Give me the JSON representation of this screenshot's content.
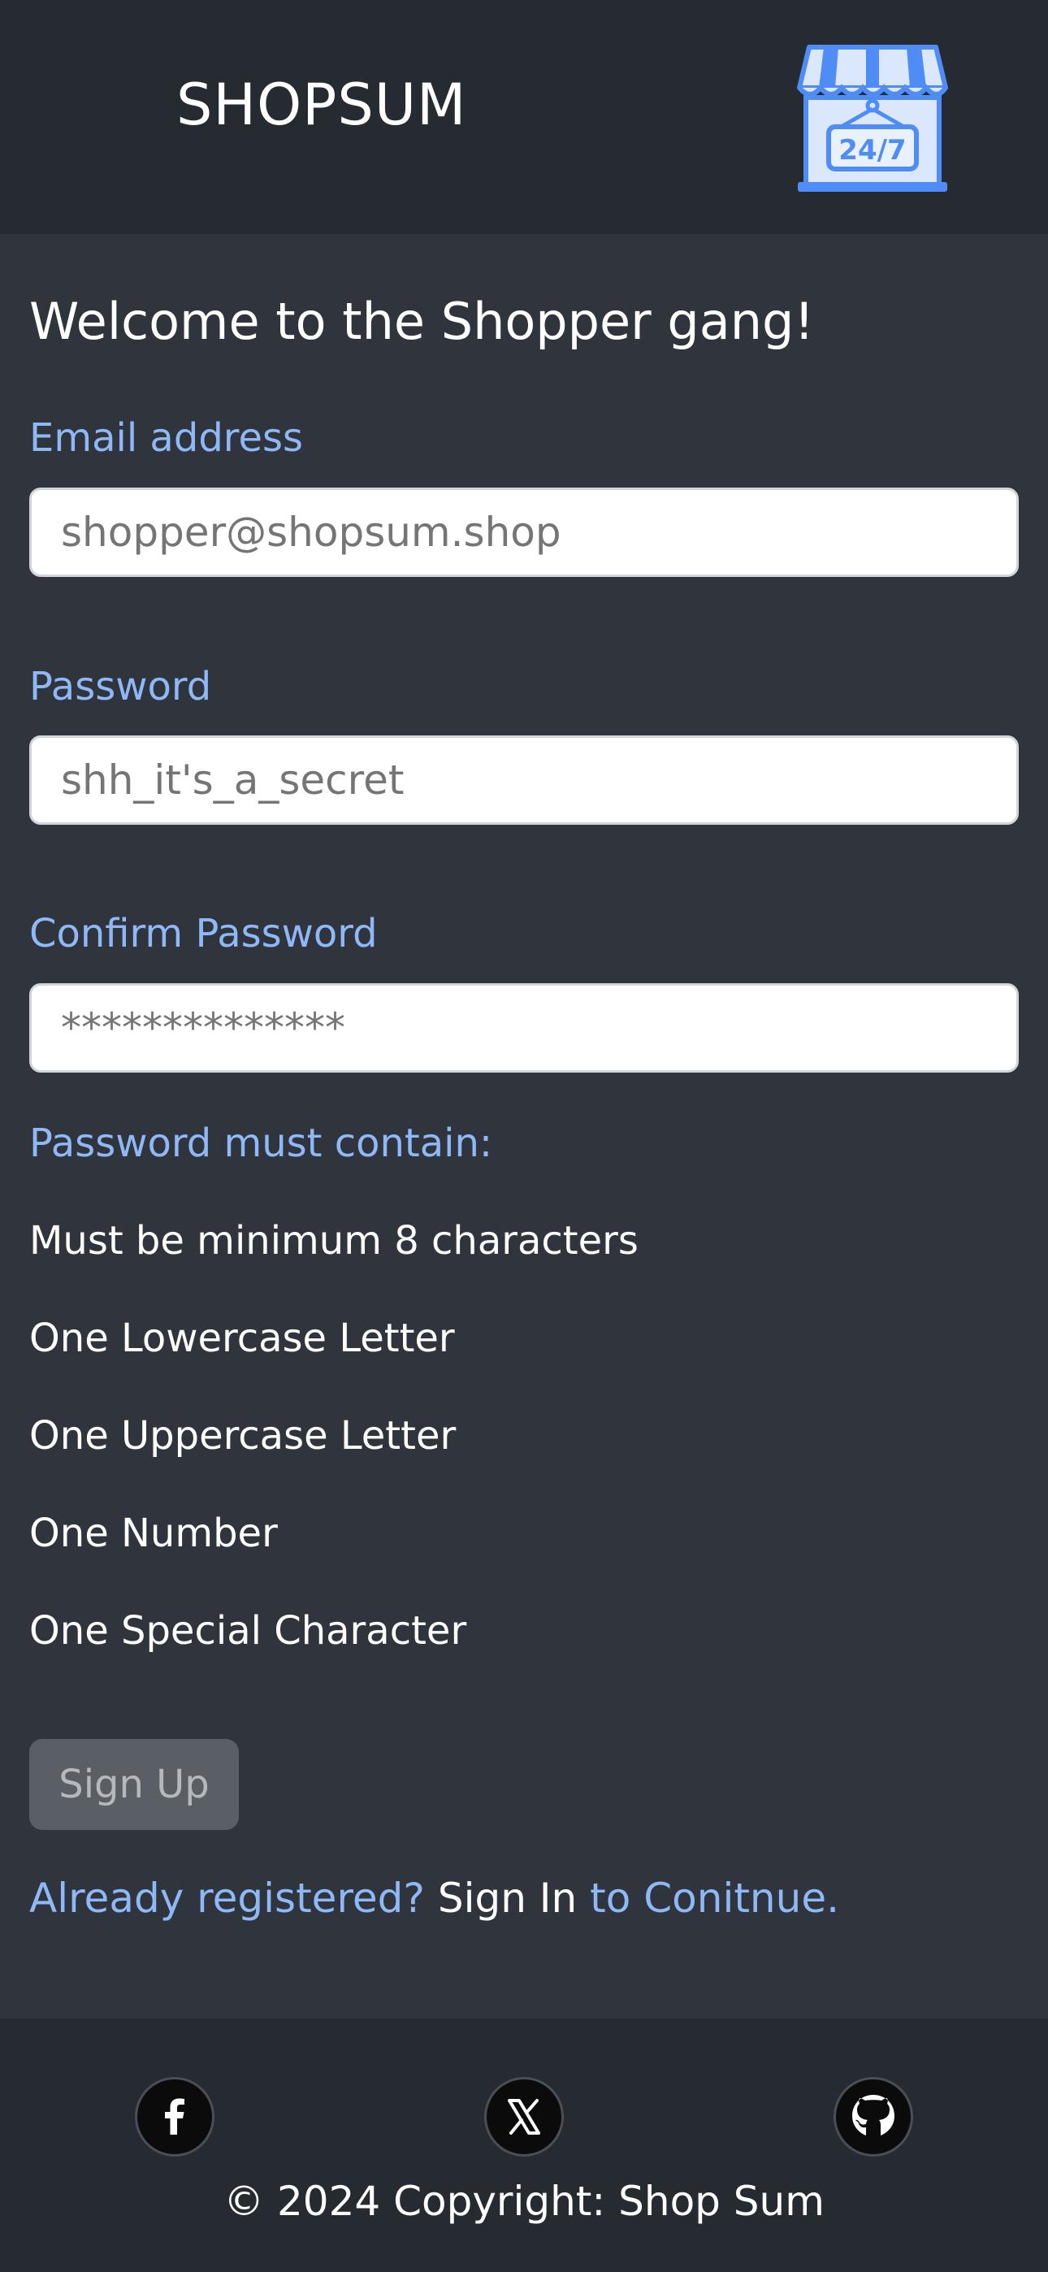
{
  "header": {
    "brand": "SHOPSUM",
    "logo_icon": "store-24-7-icon",
    "logo_text": "24/7",
    "logo_color": "#4f8cf5"
  },
  "form": {
    "title": "Welcome to the Shopper gang!",
    "email": {
      "label": "Email address",
      "placeholder": "shopper@shopsum.shop"
    },
    "password": {
      "label": "Password",
      "placeholder": "shh_it's_a_secret"
    },
    "confirm": {
      "label": "Confirm Password",
      "placeholder": "**************"
    },
    "rules_heading": "Password must contain:",
    "rules": [
      "Must be minimum 8 characters",
      "One Lowercase Letter",
      "One Uppercase Letter",
      "One Number",
      "One Special Character"
    ],
    "submit_label": "Sign Up",
    "signin_prefix": "Already registered?",
    "signin_link": "Sign In",
    "signin_suffix": "to Conitnue."
  },
  "footer": {
    "social": [
      "facebook-icon",
      "x-twitter-icon",
      "github-icon"
    ],
    "copyright": "© 2024 Copyright: Shop Sum"
  },
  "colors": {
    "page_bg": "#30353d",
    "header_bg": "#262a31",
    "label_blue": "#8fb8f7",
    "button_bg": "#5a5f66"
  }
}
